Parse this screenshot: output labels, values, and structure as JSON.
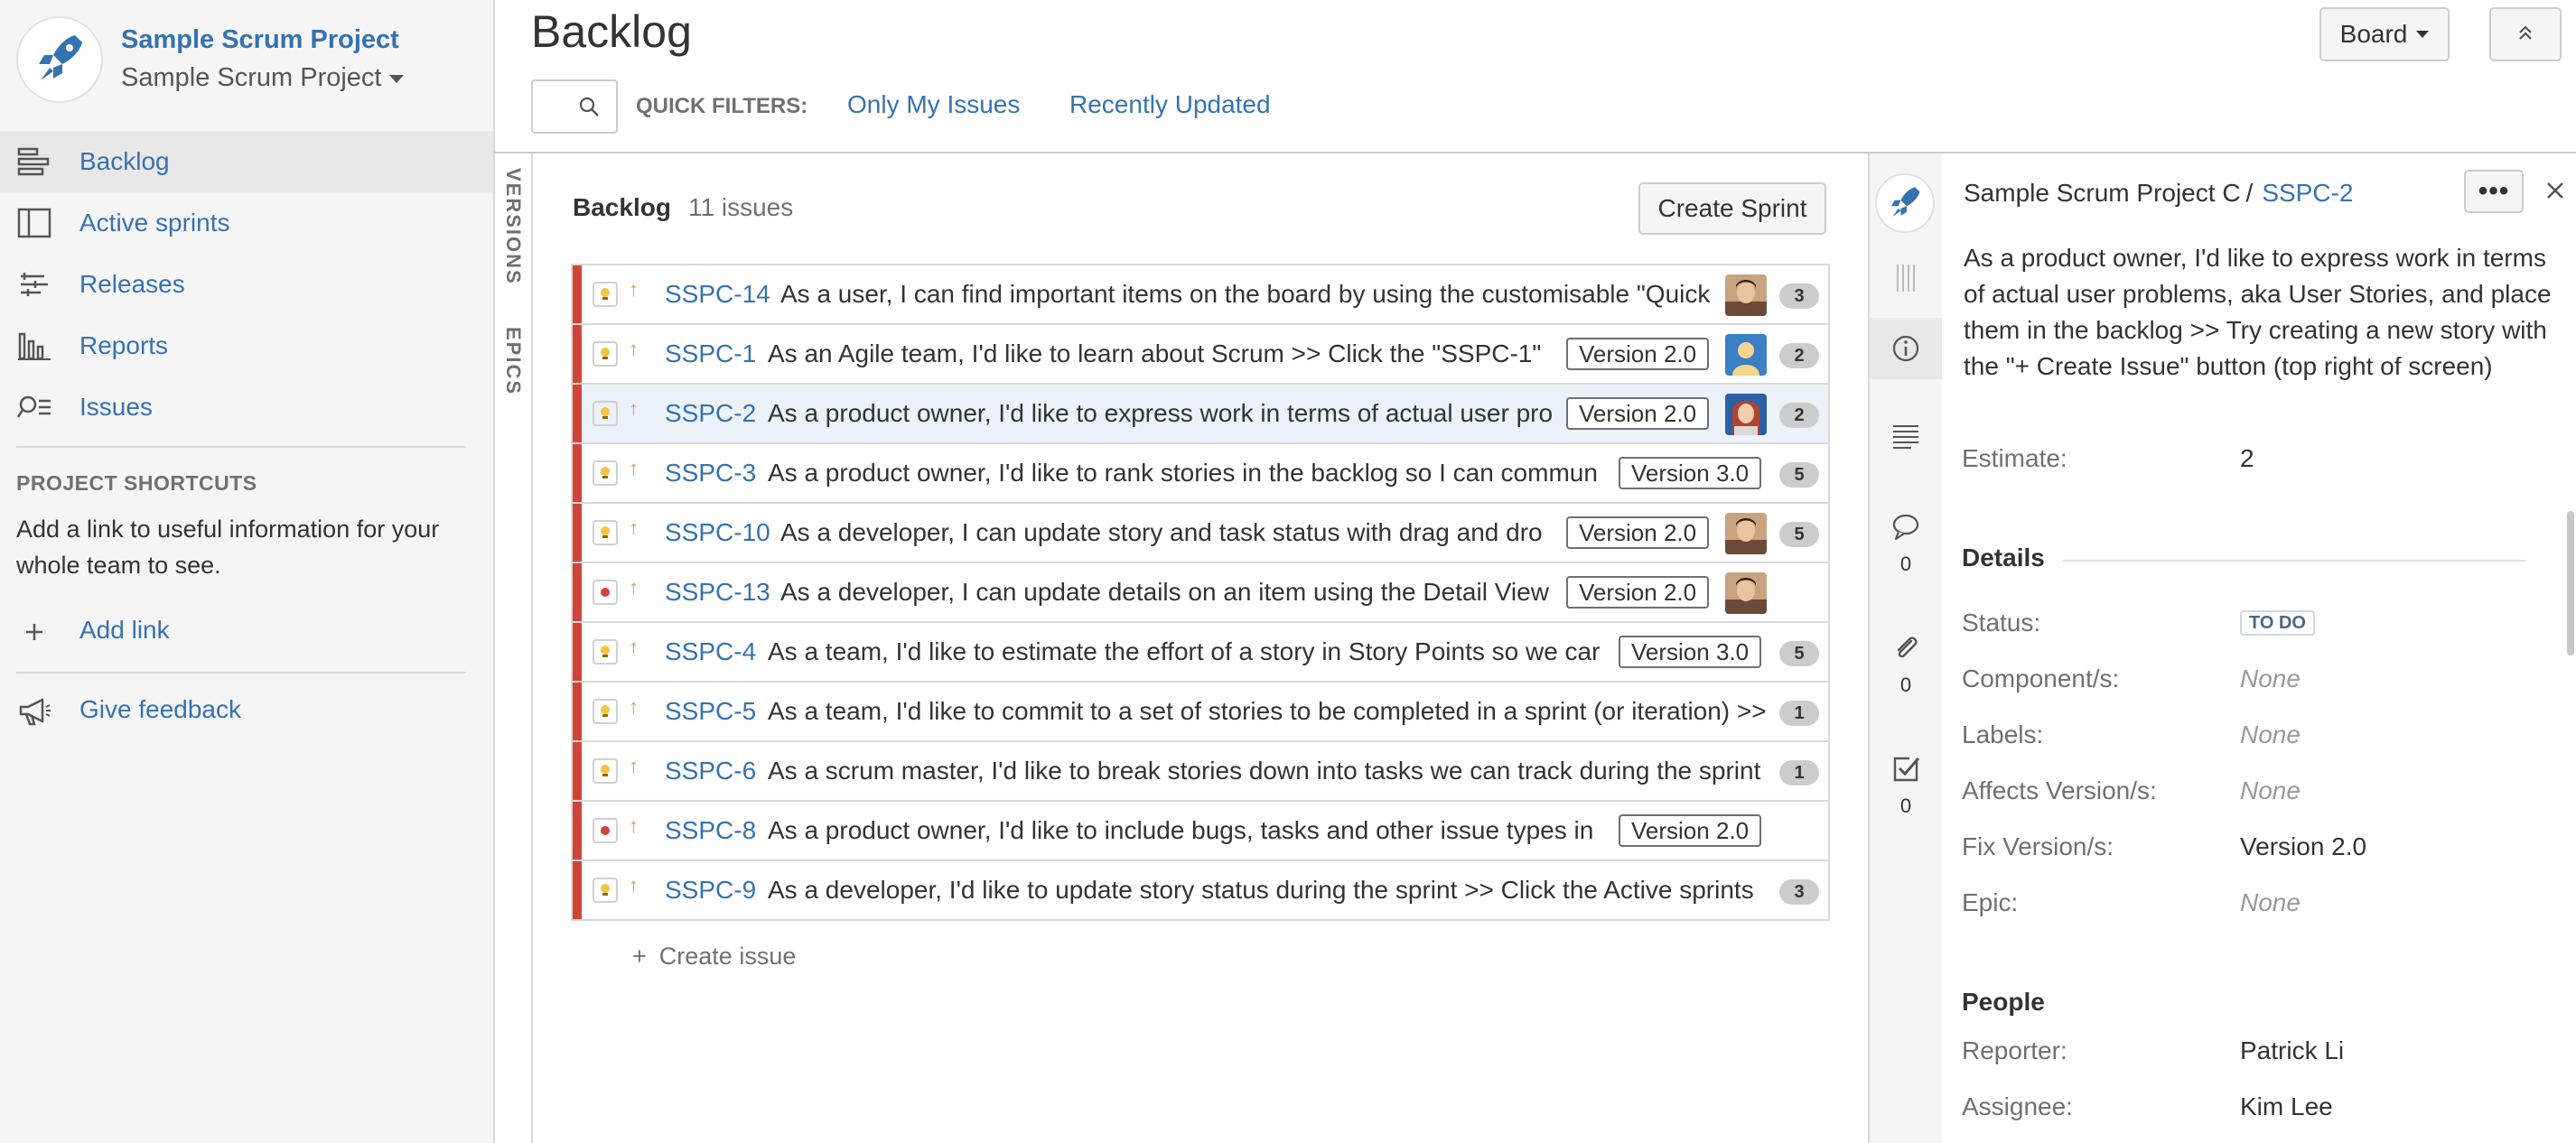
{
  "project": {
    "title": "Sample Scrum Project",
    "subtitle": "Sample Scrum Project"
  },
  "sidebar": {
    "nav": [
      {
        "label": "Backlog",
        "icon": "backlog-icon",
        "active": true
      },
      {
        "label": "Active sprints",
        "icon": "board-icon"
      },
      {
        "label": "Releases",
        "icon": "releases-icon"
      },
      {
        "label": "Reports",
        "icon": "reports-icon"
      },
      {
        "label": "Issues",
        "icon": "issues-icon"
      }
    ],
    "shortcuts_heading": "PROJECT SHORTCUTS",
    "shortcuts_text": "Add a link to useful information for your whole team to see.",
    "add_link": "Add link",
    "feedback": "Give feedback"
  },
  "header": {
    "title": "Backlog",
    "board_button": "Board",
    "quick_filters_label": "QUICK FILTERS:",
    "filters": [
      "Only My Issues",
      "Recently Updated"
    ]
  },
  "side_tabs": {
    "versions": "VERSIONS",
    "epics": "EPICS"
  },
  "backlog": {
    "title": "Backlog",
    "count": "11 issues",
    "create_sprint": "Create Sprint",
    "create_issue": "Create issue",
    "issues": [
      {
        "key": "SSPC-14",
        "summary": "As a user, I can find important items on the board by using the customisable \"Quick",
        "version": "",
        "avatar": "man",
        "estimate": "3",
        "type": "story"
      },
      {
        "key": "SSPC-1",
        "summary": "As an Agile team, I'd like to learn about Scrum >> Click the \"SSPC-1\"",
        "version": "Version 2.0",
        "avatar": "generic",
        "estimate": "2",
        "type": "story"
      },
      {
        "key": "SSPC-2",
        "summary": "As a product owner, I'd like to express work in terms of actual user pro",
        "version": "Version 2.0",
        "avatar": "woman",
        "estimate": "2",
        "type": "story",
        "selected": true
      },
      {
        "key": "SSPC-3",
        "summary": "As a product owner, I'd like to rank stories in the backlog so I can commun",
        "version": "Version 3.0",
        "avatar": "",
        "estimate": "5",
        "type": "story"
      },
      {
        "key": "SSPC-10",
        "summary": "As a developer, I can update story and task status with drag and dro",
        "version": "Version 2.0",
        "avatar": "man",
        "estimate": "5",
        "type": "story"
      },
      {
        "key": "SSPC-13",
        "summary": "As a developer, I can update details on an item using the Detail View",
        "version": "Version 2.0",
        "avatar": "man",
        "estimate": "",
        "type": "bug"
      },
      {
        "key": "SSPC-4",
        "summary": "As a team, I'd like to estimate the effort of a story in Story Points so we car",
        "version": "Version 3.0",
        "avatar": "",
        "estimate": "5",
        "type": "story"
      },
      {
        "key": "SSPC-5",
        "summary": "As a team, I'd like to commit to a set of stories to be completed in a sprint (or iteration) >>",
        "version": "",
        "avatar": "",
        "estimate": "1",
        "type": "story"
      },
      {
        "key": "SSPC-6",
        "summary": "As a scrum master, I'd like to break stories down into tasks we can track during the sprint",
        "version": "",
        "avatar": "",
        "estimate": "1",
        "type": "story"
      },
      {
        "key": "SSPC-8",
        "summary": "As a product owner, I'd like to include bugs, tasks and other issue types in",
        "version": "Version 2.0",
        "avatar": "",
        "estimate": "",
        "type": "bug"
      },
      {
        "key": "SSPC-9",
        "summary": "As a developer, I'd like to update story status during the sprint >> Click the Active sprints",
        "version": "",
        "avatar": "",
        "estimate": "3",
        "type": "story"
      }
    ]
  },
  "detail": {
    "project": "Sample Scrum Project C",
    "separator": "/",
    "key": "SSPC-2",
    "more": "•••",
    "summary": "As a product owner, I'd like to express work in terms of actual user problems, aka User Stories, and place them in the backlog >> Try creating a new story with the \"+ Create Issue\" button (top right of screen)",
    "estimate_label": "Estimate:",
    "estimate_value": "2",
    "details_heading": "Details",
    "fields": [
      {
        "label": "Status:",
        "value": "TO DO",
        "kind": "lozenge"
      },
      {
        "label": "Component/s:",
        "value": "None",
        "kind": "none"
      },
      {
        "label": "Labels:",
        "value": "None",
        "kind": "none"
      },
      {
        "label": "Affects Version/s:",
        "value": "None",
        "kind": "none"
      },
      {
        "label": "Fix Version/s:",
        "value": "Version 2.0",
        "kind": "text"
      },
      {
        "label": "Epic:",
        "value": "None",
        "kind": "none"
      }
    ],
    "people_heading": "People",
    "people": [
      {
        "label": "Reporter:",
        "value": "Patrick Li"
      },
      {
        "label": "Assignee:",
        "value": "Kim Lee"
      }
    ],
    "rail_counts": {
      "comments": "0",
      "attachments": "0",
      "subtasks": "0"
    }
  },
  "colors": {
    "link": "#3572b0",
    "priority": "#f79232",
    "rank_bar": "#d04437",
    "bug": "#d04437",
    "story_icon": "#f6c342"
  }
}
